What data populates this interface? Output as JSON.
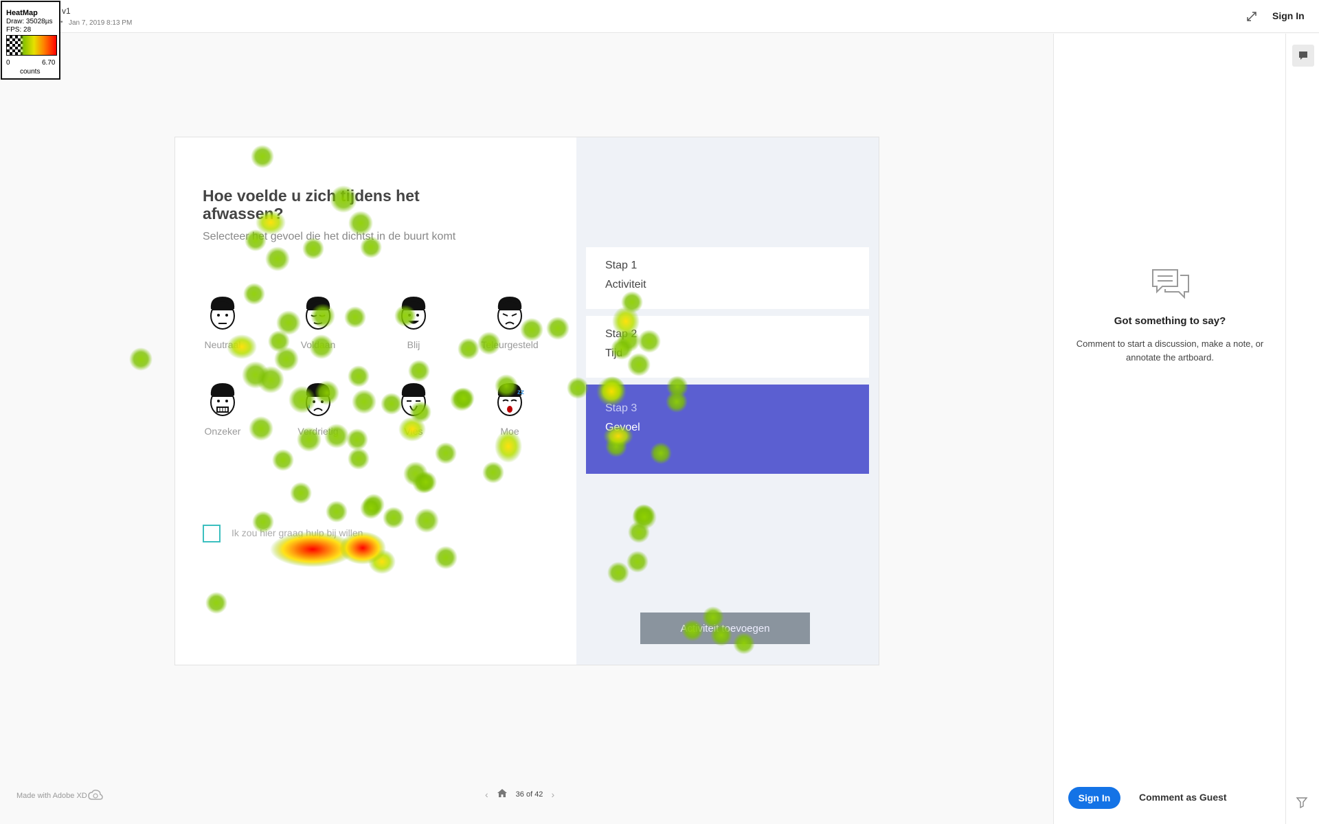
{
  "header": {
    "version": "v1",
    "date": "Jan 7, 2019 8:13 PM",
    "signin_label": "Sign In"
  },
  "heatmap_legend": {
    "title": "HeatMap",
    "draw": "Draw: 35028µs",
    "fps": "FPS: 28",
    "min": "0",
    "max": "6.70",
    "unit": "counts"
  },
  "artboard": {
    "title": "Hoe voelde u zich tijdens het afwassen?",
    "subtitle": "Selecteer het gevoel die het dichtst in de buurt komt",
    "emotions": [
      {
        "label": "Neutraal",
        "icon": "neutral-face-icon"
      },
      {
        "label": "Voldaan",
        "icon": "content-face-icon"
      },
      {
        "label": "Blij",
        "icon": "happy-face-icon"
      },
      {
        "label": "Teleurgesteld",
        "icon": "disappointed-face-icon"
      },
      {
        "label": "Onzeker",
        "icon": "unsure-face-icon"
      },
      {
        "label": "Verdrietig",
        "icon": "sad-face-icon"
      },
      {
        "label": "Vies",
        "icon": "disgusted-face-icon"
      },
      {
        "label": "Moe",
        "icon": "tired-face-icon"
      }
    ],
    "checkbox_label": "Ik zou hier graag hulp bij willen",
    "steps": [
      {
        "number": "Stap 1",
        "name": "Activiteit",
        "active": false
      },
      {
        "number": "Stap 2",
        "name": "Tijd",
        "active": false
      },
      {
        "number": "Stap 3",
        "name": "Gevoel",
        "active": true
      }
    ],
    "add_button_label": "Activiteit toevoegen",
    "active_color": "#5b5fd1"
  },
  "comments": {
    "title": "Got something to say?",
    "text": "Comment to start a discussion, make a note, or annotate the artboard.",
    "signin_label": "Sign In",
    "guest_label": "Comment as Guest"
  },
  "footer": {
    "made_with": "Made with Adobe XD",
    "page_indicator": "36 of 42"
  }
}
